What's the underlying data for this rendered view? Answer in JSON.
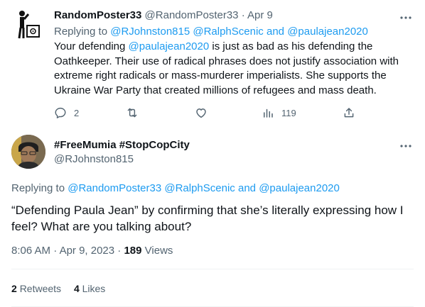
{
  "reply_tweet": {
    "display_name": "RandomPoster33",
    "handle": "@RandomPoster33",
    "separator": "·",
    "date": "Apr 9",
    "replying_prefix": "Replying to",
    "replying_user1": "@RJohnston815",
    "replying_user2": "@RalphScenic",
    "replying_and": "and",
    "replying_user3": "@paulajean2020",
    "body_pre": "Your defending",
    "body_mention": "@paulajean2020",
    "body_post": "is just as bad as his defending the Oathkeeper. Their use of radical phrases does not justify association with extreme right radicals or mass-murderer imperialists. She supports the Ukraine War Party that created millions of refugees and mass death.",
    "reply_count": "2",
    "views_count": "119",
    "icons": [
      "reply-icon",
      "retweet-icon",
      "like-icon",
      "views-icon",
      "share-icon",
      "more-icon"
    ]
  },
  "main_tweet": {
    "display_name": "#FreeMumia #StopCopCity",
    "handle": "@RJohnston815",
    "replying_prefix": "Replying to",
    "replying_user1": "@RandomPoster33",
    "replying_user2": "@RalphScenic",
    "replying_and": "and",
    "replying_user3": "@paulajean2020",
    "text": "“Defending Paula Jean” by confirming that she’s literally expressing how I feel? What are you talking about?",
    "time": "8:06 AM",
    "dot": "·",
    "date": "Apr 9, 2023",
    "views_count": "189",
    "views_label": "Views",
    "retweets_count": "2",
    "retweets_label": "Retweets",
    "likes_count": "4",
    "likes_label": "Likes"
  },
  "colors": {
    "link": "#1d9bf0",
    "muted": "#536471",
    "text": "#0f1419",
    "divider": "#eff3f4"
  }
}
